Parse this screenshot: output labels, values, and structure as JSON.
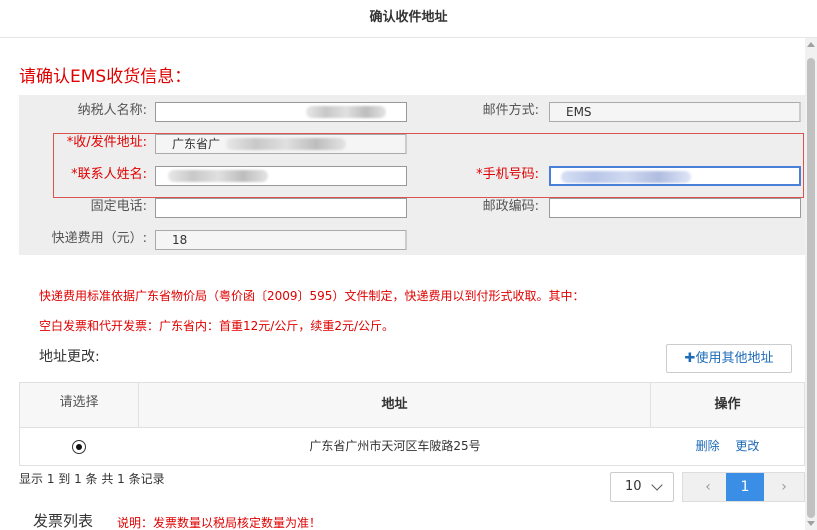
{
  "window": {
    "title": "确认收件地址"
  },
  "section_title": "请确认EMS收货信息：",
  "form": {
    "taxpayer_label": "纳税人名称:",
    "taxpayer_value": "",
    "mail_method_label": "邮件方式:",
    "mail_method_value": "EMS",
    "address_label": "*收/发件地址:",
    "address_value": "广东省广",
    "contact_label": "*联系人姓名:",
    "contact_value": "",
    "mobile_label": "*手机号码:",
    "mobile_value": "",
    "phone_label": "固定电话:",
    "phone_value": "",
    "postcode_label": "邮政编码:",
    "postcode_value": "",
    "fee_label": "快递费用（元）:",
    "fee_value": "18"
  },
  "notes": {
    "line1": "快递费用标准依据广东省物价局（粤价函〔2009〕595）文件制定，快递费用以到付形式收取。其中：",
    "line2": "空白发票和代开发票：广东省内：首重12元/公斤，续重2元/公斤。"
  },
  "address_change": {
    "title": "地址更改:",
    "other_button": "✚使用其他地址"
  },
  "table": {
    "headers": {
      "select": "请选择",
      "address": "地址",
      "action": "操作"
    },
    "rows": [
      {
        "selected": true,
        "address": "广东省广州市天河区车陂路25号",
        "delete": "删除",
        "edit": "更改"
      }
    ]
  },
  "pagination": {
    "summary": "显示 1 到 1 条 共 1 条记录",
    "page_size": "10",
    "prev": "‹",
    "current": "1",
    "next": "›"
  },
  "invoice": {
    "title": "发票列表",
    "note": "说明：发票数量以税局核定数量为准！"
  }
}
